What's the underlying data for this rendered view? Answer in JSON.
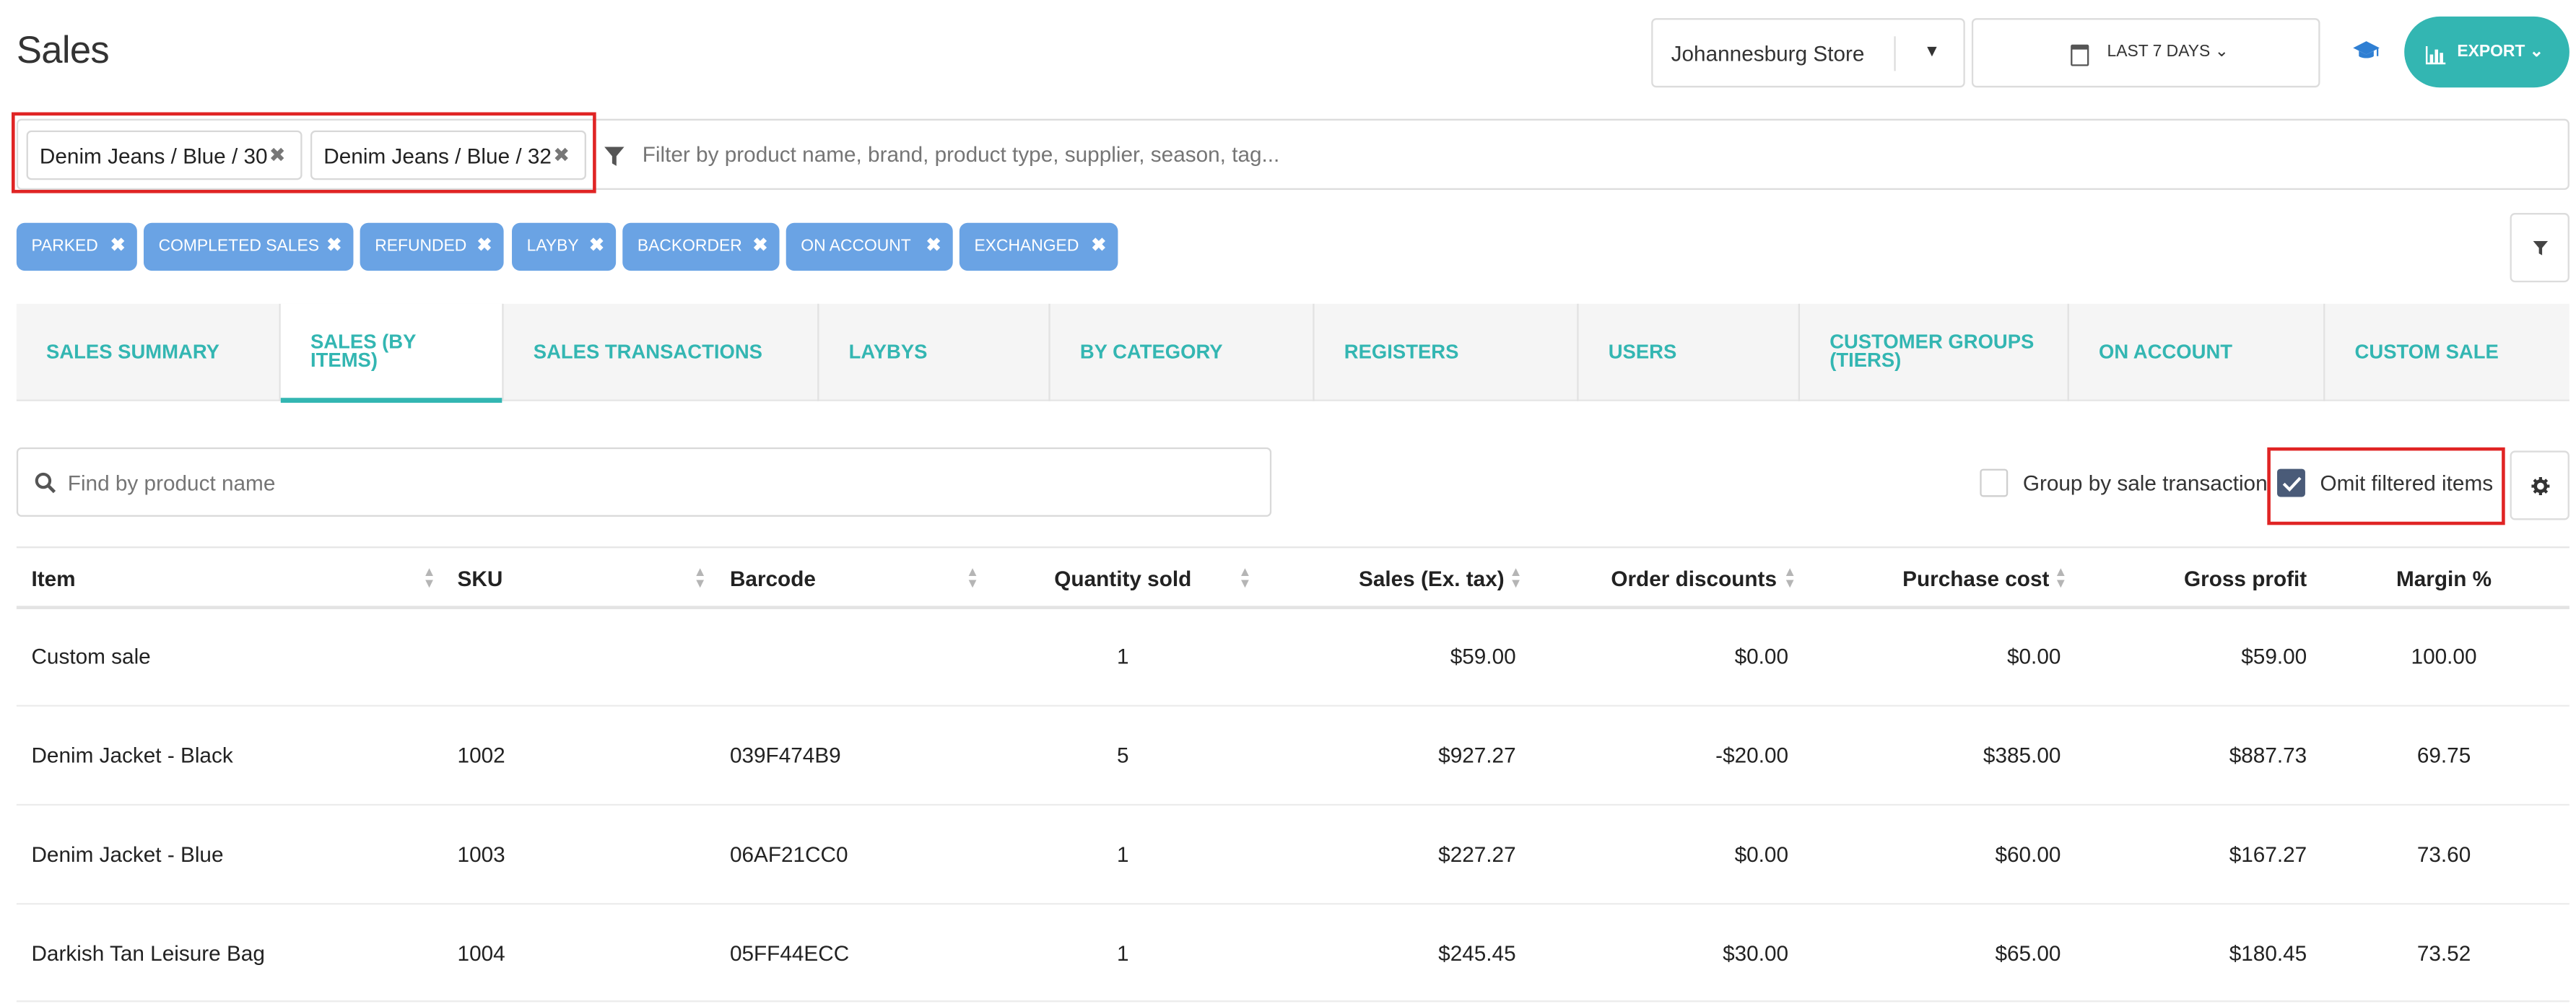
{
  "page": {
    "title": "Sales"
  },
  "header": {
    "store": "Johannesburg Store",
    "date_range": "LAST 7 DAYS",
    "export_label": "EXPORT"
  },
  "filters": {
    "chips": [
      "Denim Jeans / Blue / 30",
      "Denim Jeans / Blue / 32"
    ],
    "placeholder": "Filter by product name, brand, product type, supplier, season, tag...",
    "tags": [
      "PARKED",
      "COMPLETED SALES",
      "REFUNDED",
      "LAYBY",
      "BACKORDER",
      "ON ACCOUNT",
      "EXCHANGED"
    ]
  },
  "tabs": [
    {
      "label": "SALES SUMMARY"
    },
    {
      "label": "SALES (BY ITEMS)"
    },
    {
      "label": "SALES TRANSACTIONS"
    },
    {
      "label": "LAYBYS"
    },
    {
      "label": "BY CATEGORY"
    },
    {
      "label": "REGISTERS"
    },
    {
      "label": "USERS"
    },
    {
      "label": "CUSTOMER GROUPS (TIERS)"
    },
    {
      "label": "ON ACCOUNT"
    },
    {
      "label": "CUSTOM SALE"
    }
  ],
  "active_tab": 1,
  "search": {
    "placeholder": "Find by product name"
  },
  "options": {
    "group_by_sale": {
      "label": "Group by sale transaction",
      "checked": false
    },
    "omit_filtered": {
      "label": "Omit filtered items",
      "checked": true
    }
  },
  "table": {
    "columns": [
      "Item",
      "SKU",
      "Barcode",
      "Quantity sold",
      "Sales (Ex. tax)",
      "Order discounts",
      "Purchase cost",
      "Gross profit",
      "Margin %"
    ],
    "rows": [
      [
        "Custom sale",
        "",
        "",
        "1",
        "$59.00",
        "$0.00",
        "$0.00",
        "$59.00",
        "100.00"
      ],
      [
        "Denim Jacket - Black",
        "1002",
        "039F474B9",
        "5",
        "$927.27",
        "-$20.00",
        "$385.00",
        "$887.73",
        "69.75"
      ],
      [
        "Denim Jacket - Blue",
        "1003",
        "06AF21CC0",
        "1",
        "$227.27",
        "$0.00",
        "$60.00",
        "$167.27",
        "73.60"
      ],
      [
        "Darkish Tan Leisure Bag",
        "1004",
        "05FF44ECC",
        "1",
        "$245.45",
        "$30.00",
        "$65.00",
        "$180.45",
        "73.52"
      ]
    ]
  },
  "colors": {
    "accent": "#33b6b2",
    "tag": "#6aa3e4",
    "highlight": "#e02424",
    "checkbox": "#4a5b78"
  }
}
